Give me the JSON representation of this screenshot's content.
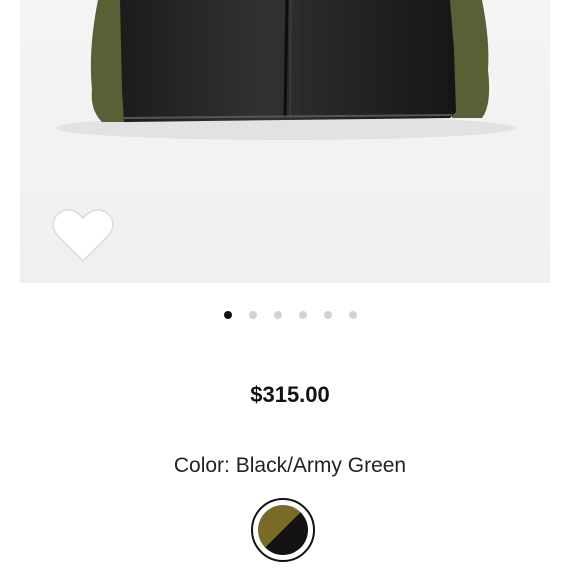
{
  "product": {
    "price": "$315.00",
    "color_label": "Color:",
    "color_value": "Black/Army Green",
    "swatch_colors": {
      "left": "#7a6a28",
      "right": "#121212"
    }
  },
  "gallery": {
    "dot_count": 6,
    "active_index": 0
  },
  "icons": {
    "favorite": "heart-icon"
  }
}
